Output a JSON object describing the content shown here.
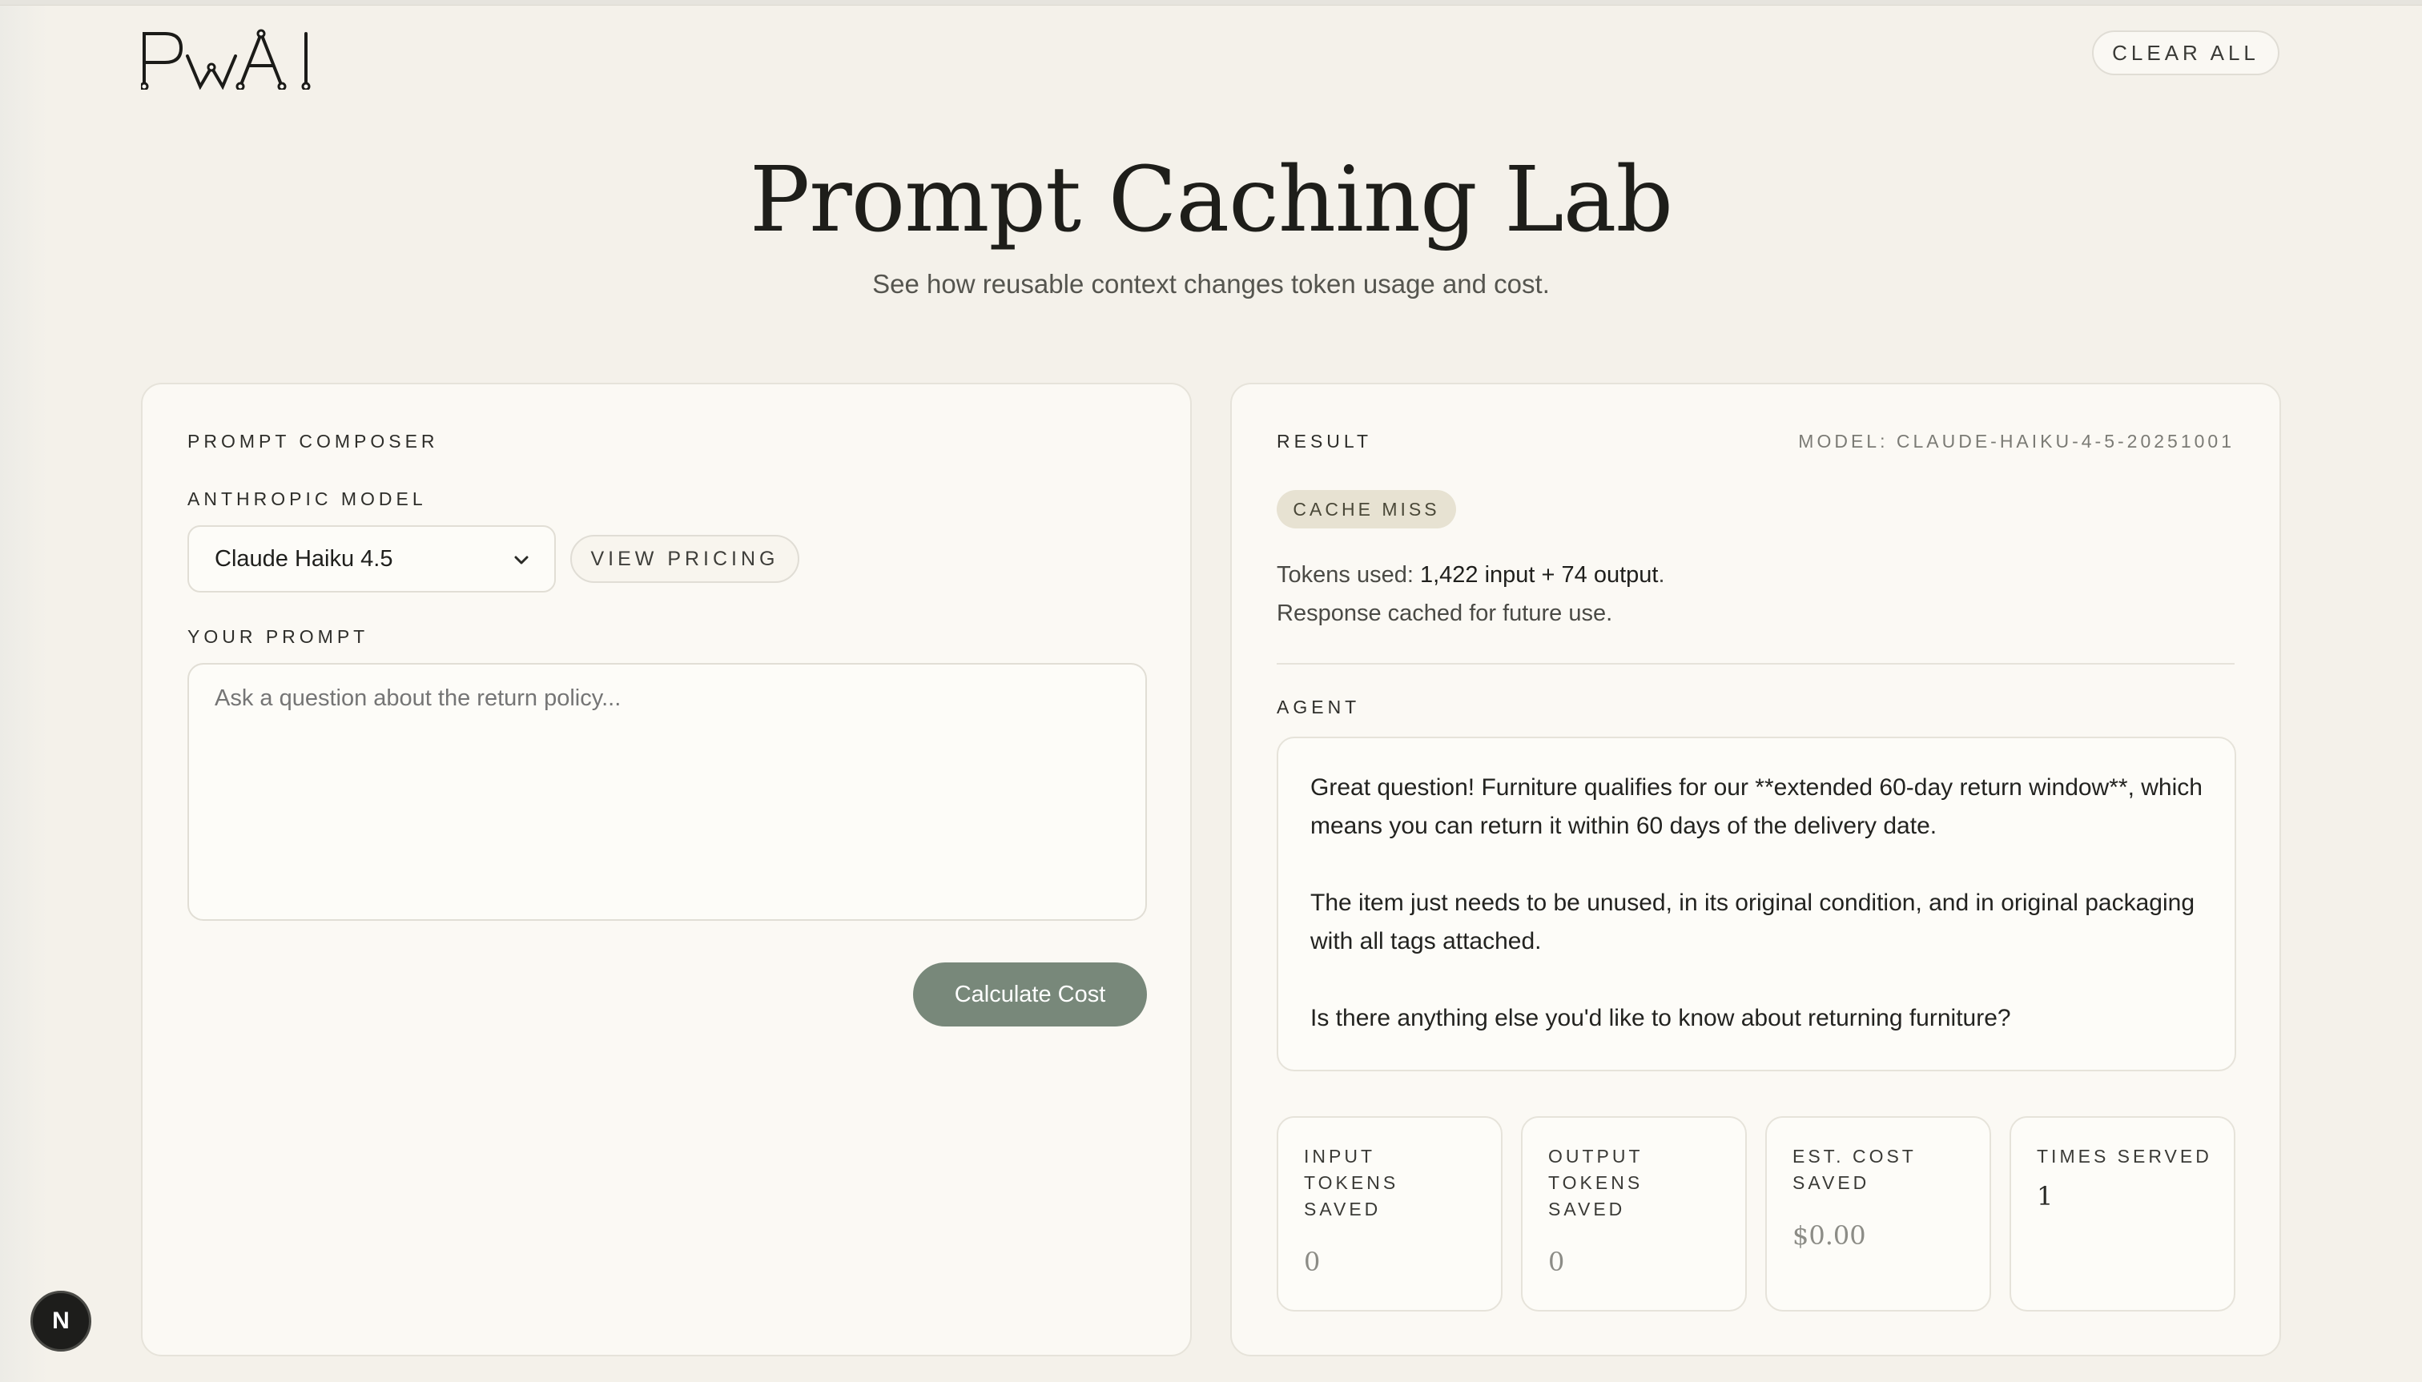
{
  "header": {
    "logo_text": "PwAI",
    "clear_all_label": "CLEAR ALL"
  },
  "hero": {
    "title": "Prompt Caching Lab",
    "subtitle": "See how reusable context changes token usage and cost."
  },
  "composer": {
    "section_label": "PROMPT COMPOSER",
    "model_label": "ANTHROPIC MODEL",
    "model_value": "Claude Haiku 4.5",
    "view_pricing_label": "VIEW PRICING",
    "prompt_label": "YOUR PROMPT",
    "prompt_placeholder": "Ask a question about the return policy...",
    "calculate_label": "Calculate Cost"
  },
  "result": {
    "section_label": "RESULT",
    "model_tag": "MODEL: CLAUDE-HAIKU-4-5-20251001",
    "cache_status": "CACHE MISS",
    "tokens_prefix": "Tokens used: ",
    "tokens_value": "1,422 input + 74 output",
    "tokens_suffix": ".",
    "cache_note": "Response cached for future use.",
    "agent_label": "AGENT",
    "agent_paragraphs": [
      "Great question! Furniture qualifies for our **extended 60-day return window**, which means you can return it within 60 days of the delivery date.",
      "The item just needs to be unused, in its original condition, and in original packaging with all tags attached.",
      "Is there anything else you'd like to know about returning furniture?"
    ],
    "stats": [
      {
        "label": "INPUT TOKENS SAVED",
        "value": "0"
      },
      {
        "label": "OUTPUT TOKENS SAVED",
        "value": "0"
      },
      {
        "label": "EST. COST SAVED",
        "value": "$0.00"
      },
      {
        "label": "TIMES SERVED",
        "value": "1"
      }
    ]
  },
  "footer": {
    "badge_letter": "N"
  },
  "colors": {
    "background": "#f4f1ea",
    "card": "#fbf9f4",
    "accent_button": "#78887a",
    "cache_badge": "#e7e2d2"
  }
}
